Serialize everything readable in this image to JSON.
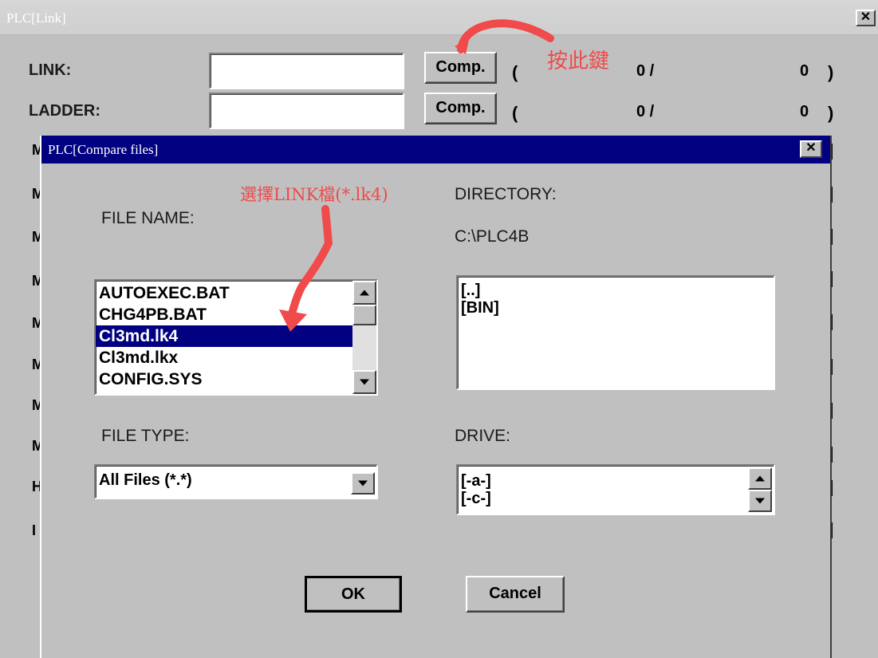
{
  "window": {
    "title": "PLC[Link]",
    "close_glyph": "✕",
    "rows": [
      {
        "label": "LINK:",
        "button": "Comp.",
        "open_paren": "(",
        "left_count": "0 /",
        "right_count": "0",
        "close_paren": ")"
      },
      {
        "label": "LADDER:",
        "button": "Comp.",
        "open_paren": "(",
        "left_count": "0 /",
        "right_count": "0",
        "close_paren": ")"
      }
    ],
    "hidden_row_letters": [
      "M",
      "M",
      "M",
      "M",
      "M",
      "M",
      "M",
      "M",
      "H",
      "I"
    ]
  },
  "annotations": {
    "press_key": "按此鍵",
    "select_link": "選擇LINK檔(*.lk4)",
    "color": "#f04a4a"
  },
  "dialog": {
    "title": "PLC[Compare files]",
    "close_glyph": "✕",
    "file_name_label": "FILE NAME:",
    "directory_label": "DIRECTORY:",
    "directory_path": "C:\\PLC4B",
    "files": [
      "AUTOEXEC.BAT",
      "CHG4PB.BAT",
      "Cl3md.lk4",
      "Cl3md.lkx",
      "CONFIG.SYS"
    ],
    "selected_file": "Cl3md.lk4",
    "directories": [
      "[..]",
      "[BIN]"
    ],
    "file_type_label": "FILE TYPE:",
    "file_type_value": "All Files (*.*)",
    "drive_label": "DRIVE:",
    "drives": [
      "[-a-]",
      "[-c-]"
    ],
    "ok_label": "OK",
    "cancel_label": "Cancel"
  },
  "colors": {
    "title_active": "#000080",
    "window_bg": "#c0c0c0"
  }
}
